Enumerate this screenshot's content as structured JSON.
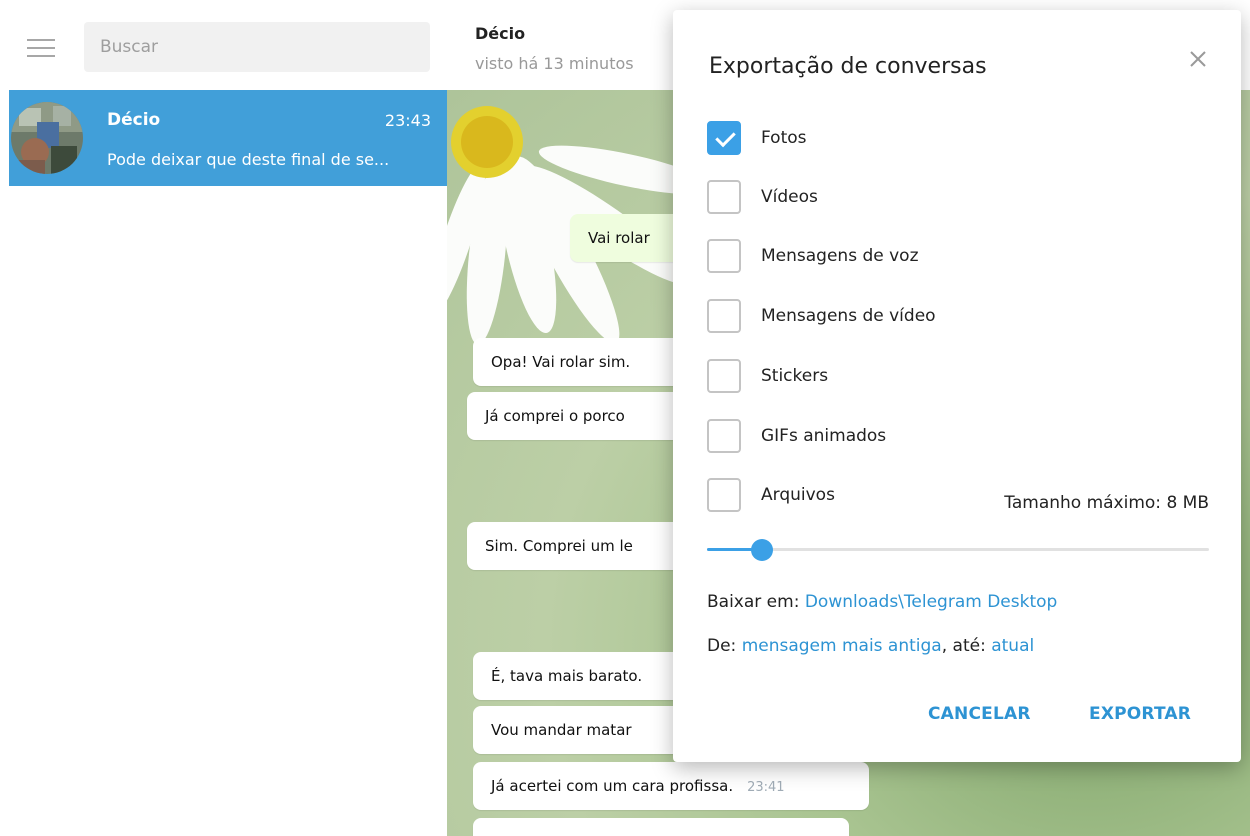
{
  "sidebar": {
    "search_placeholder": "Buscar",
    "chat": {
      "name": "Décio",
      "time": "23:43",
      "preview": "Pode deixar que deste final de se..."
    }
  },
  "header": {
    "name": "Décio",
    "status": "visto há 13 minutos"
  },
  "messages": [
    {
      "text": "Vai rolar",
      "time": "",
      "outgoing": true
    },
    {
      "text": "Opa! Vai rolar sim.",
      "time": "",
      "outgoing": false
    },
    {
      "text": "Já comprei o porco",
      "time": "",
      "outgoing": false
    },
    {
      "text": "Sim. Comprei um le",
      "time": "",
      "outgoing": false
    },
    {
      "text": "É, tava mais barato.",
      "time": "",
      "outgoing": false
    },
    {
      "text": "Vou mandar matar",
      "time": "",
      "outgoing": false
    },
    {
      "text": "Já acertei com um cara profissa.",
      "time": "23:41",
      "outgoing": false
    }
  ],
  "dialog": {
    "title": "Exportação de conversas",
    "close_icon": "close-icon",
    "options": [
      {
        "label": "Fotos",
        "checked": true
      },
      {
        "label": "Vídeos",
        "checked": false
      },
      {
        "label": "Mensagens de voz",
        "checked": false
      },
      {
        "label": "Mensagens de vídeo",
        "checked": false
      },
      {
        "label": "Stickers",
        "checked": false
      },
      {
        "label": "GIFs animados",
        "checked": false
      },
      {
        "label": "Arquivos",
        "checked": false
      }
    ],
    "max_size_label": "Tamanho máximo: 8 MB",
    "slider_fraction": 0.11,
    "download_prefix": "Baixar em: ",
    "download_path": "Downloads\\Telegram Desktop",
    "from_prefix": "De: ",
    "from_value": "mensagem mais antiga",
    "to_prefix": ", até: ",
    "to_value": "atual",
    "cancel_label": "CANCELAR",
    "export_label": "EXPORTAR"
  },
  "colors": {
    "accent": "#419fd9",
    "link": "#2d93d3",
    "checkbox": "#3ba0e6"
  }
}
